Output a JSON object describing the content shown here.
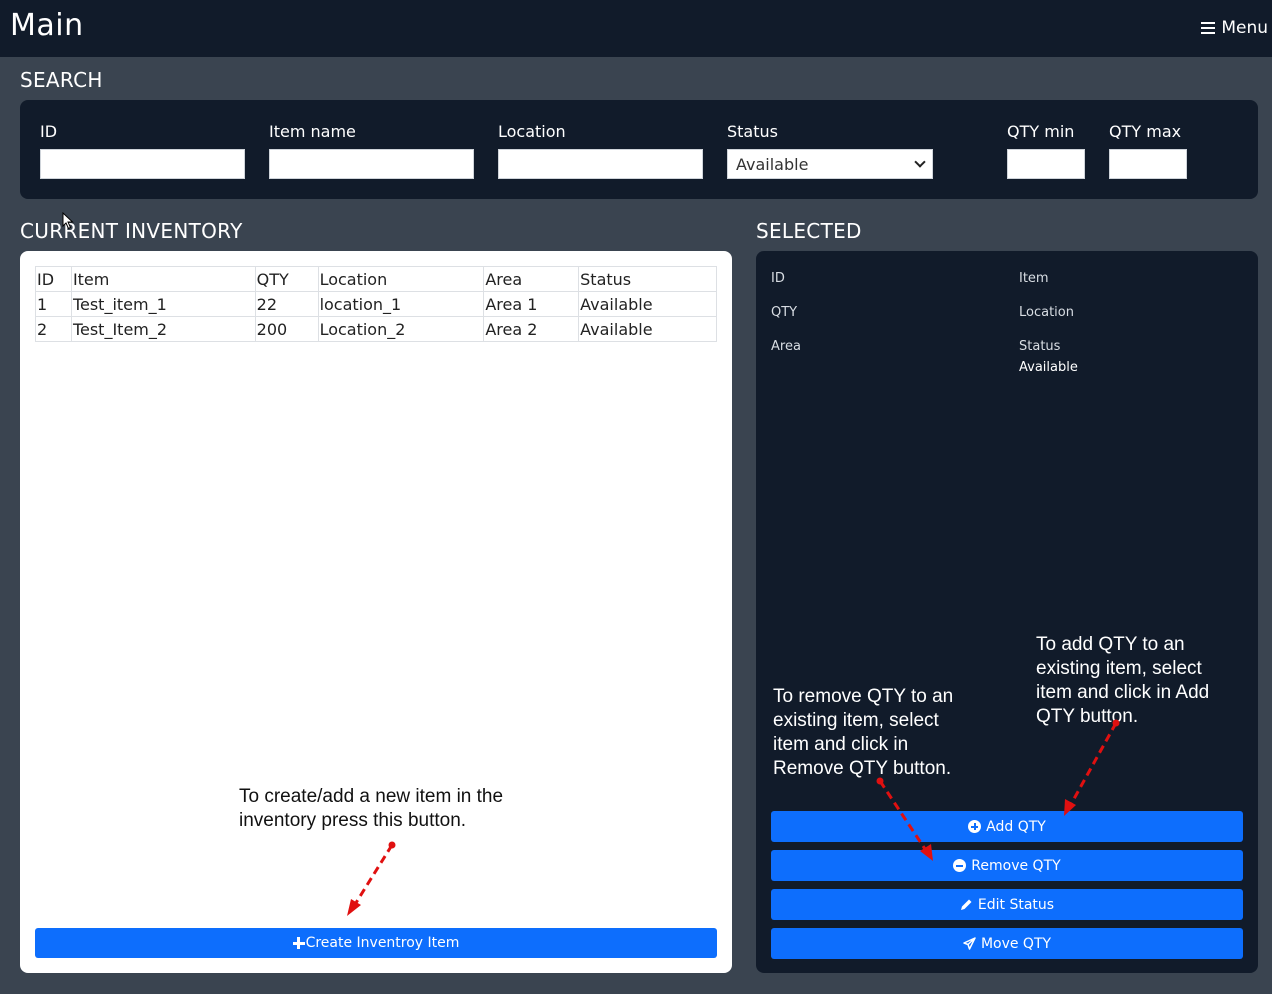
{
  "header": {
    "title": "Main",
    "menu_label": "Menu"
  },
  "search": {
    "heading": "SEARCH",
    "fields": {
      "id": {
        "label": "ID",
        "value": ""
      },
      "item_name": {
        "label": "Item name",
        "value": ""
      },
      "location": {
        "label": "Location",
        "value": ""
      },
      "status": {
        "label": "Status",
        "selected": "Available"
      },
      "qty_min": {
        "label": "QTY min",
        "value": ""
      },
      "qty_max": {
        "label": "QTY max",
        "value": ""
      }
    }
  },
  "inventory": {
    "heading": "CURRENT INVENTORY",
    "columns": [
      "ID",
      "Item",
      "QTY",
      "Location",
      "Area",
      "Status"
    ],
    "rows": [
      [
        "1",
        "Test_item_1",
        "22",
        "location_1",
        "Area 1",
        "Available"
      ],
      [
        "2",
        "Test_Item_2",
        "200",
        "Location_2",
        "Area 2",
        "Available"
      ]
    ],
    "create_button": "Create Inventroy Item"
  },
  "selected": {
    "heading": "SELECTED",
    "labels": {
      "id": "ID",
      "item": "Item",
      "qty": "QTY",
      "location": "Location",
      "area": "Area",
      "status": "Status"
    },
    "values": {
      "status": "Available"
    },
    "buttons": {
      "add_qty": "Add QTY",
      "remove_qty": "Remove QTY",
      "edit_status": "Edit Status",
      "move_qty": "Move QTY"
    }
  },
  "annotations": {
    "create": "To create/add a new item in the\ninventory press this button.",
    "remove": "To remove QTY to an\nexisting item, select\nitem and click in\nRemove QTY button.",
    "add": "To add QTY to an\nexisting item, select\nitem and click in Add\nQTY button."
  },
  "colors": {
    "header_bg": "#111b2a",
    "page_bg": "#3a4450",
    "panel_bg": "#111b2a",
    "button_blue": "#0d6efd",
    "annotation_arrow": "#e01010"
  },
  "icons": {
    "menu": "menu-icon",
    "add_qty": "plus-circle-icon",
    "remove_qty": "minus-circle-icon",
    "edit_status": "pencil-icon",
    "move_qty": "paper-plane-icon",
    "create": "plus-icon"
  }
}
